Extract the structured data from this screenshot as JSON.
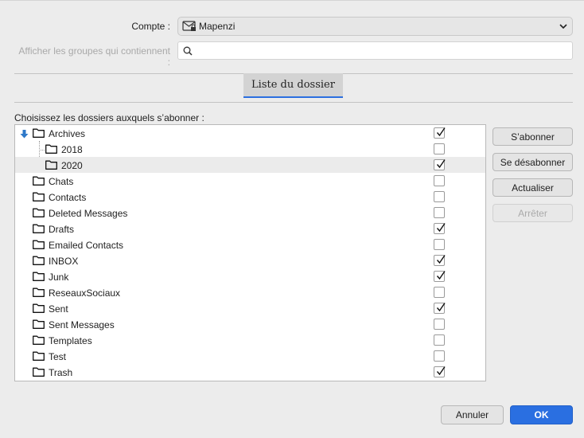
{
  "form": {
    "account_label": "Compte :",
    "account_value": "Mapenzi",
    "filter_label": "Afficher les groupes qui contiennent :",
    "filter_value": ""
  },
  "tab": {
    "label": "Liste du dossier"
  },
  "list": {
    "heading": "Choisissez les dossiers auxquels s’abonner :",
    "folders": [
      {
        "name": "Archives",
        "checked": true,
        "level": 0,
        "expanded": true
      },
      {
        "name": "2018",
        "checked": false,
        "level": 1
      },
      {
        "name": "2020",
        "checked": true,
        "level": 1,
        "selected": true
      },
      {
        "name": "Chats",
        "checked": false,
        "level": 0
      },
      {
        "name": "Contacts",
        "checked": false,
        "level": 0
      },
      {
        "name": "Deleted Messages",
        "checked": false,
        "level": 0
      },
      {
        "name": "Drafts",
        "checked": true,
        "level": 0
      },
      {
        "name": "Emailed Contacts",
        "checked": false,
        "level": 0
      },
      {
        "name": "INBOX",
        "checked": true,
        "level": 0
      },
      {
        "name": "Junk",
        "checked": true,
        "level": 0
      },
      {
        "name": "ReseauxSociaux",
        "checked": false,
        "level": 0
      },
      {
        "name": "Sent",
        "checked": true,
        "level": 0
      },
      {
        "name": "Sent Messages",
        "checked": false,
        "level": 0
      },
      {
        "name": "Templates",
        "checked": false,
        "level": 0
      },
      {
        "name": "Test",
        "checked": false,
        "level": 0
      },
      {
        "name": "Trash",
        "checked": true,
        "level": 0
      }
    ]
  },
  "actions": {
    "subscribe": "S’abonner",
    "unsubscribe": "Se désabonner",
    "refresh": "Actualiser",
    "stop": "Arrêter"
  },
  "footer": {
    "cancel": "Annuler",
    "ok": "OK"
  },
  "colors": {
    "accent": "#2a6fe1",
    "expand_arrow": "#2f79c9"
  }
}
